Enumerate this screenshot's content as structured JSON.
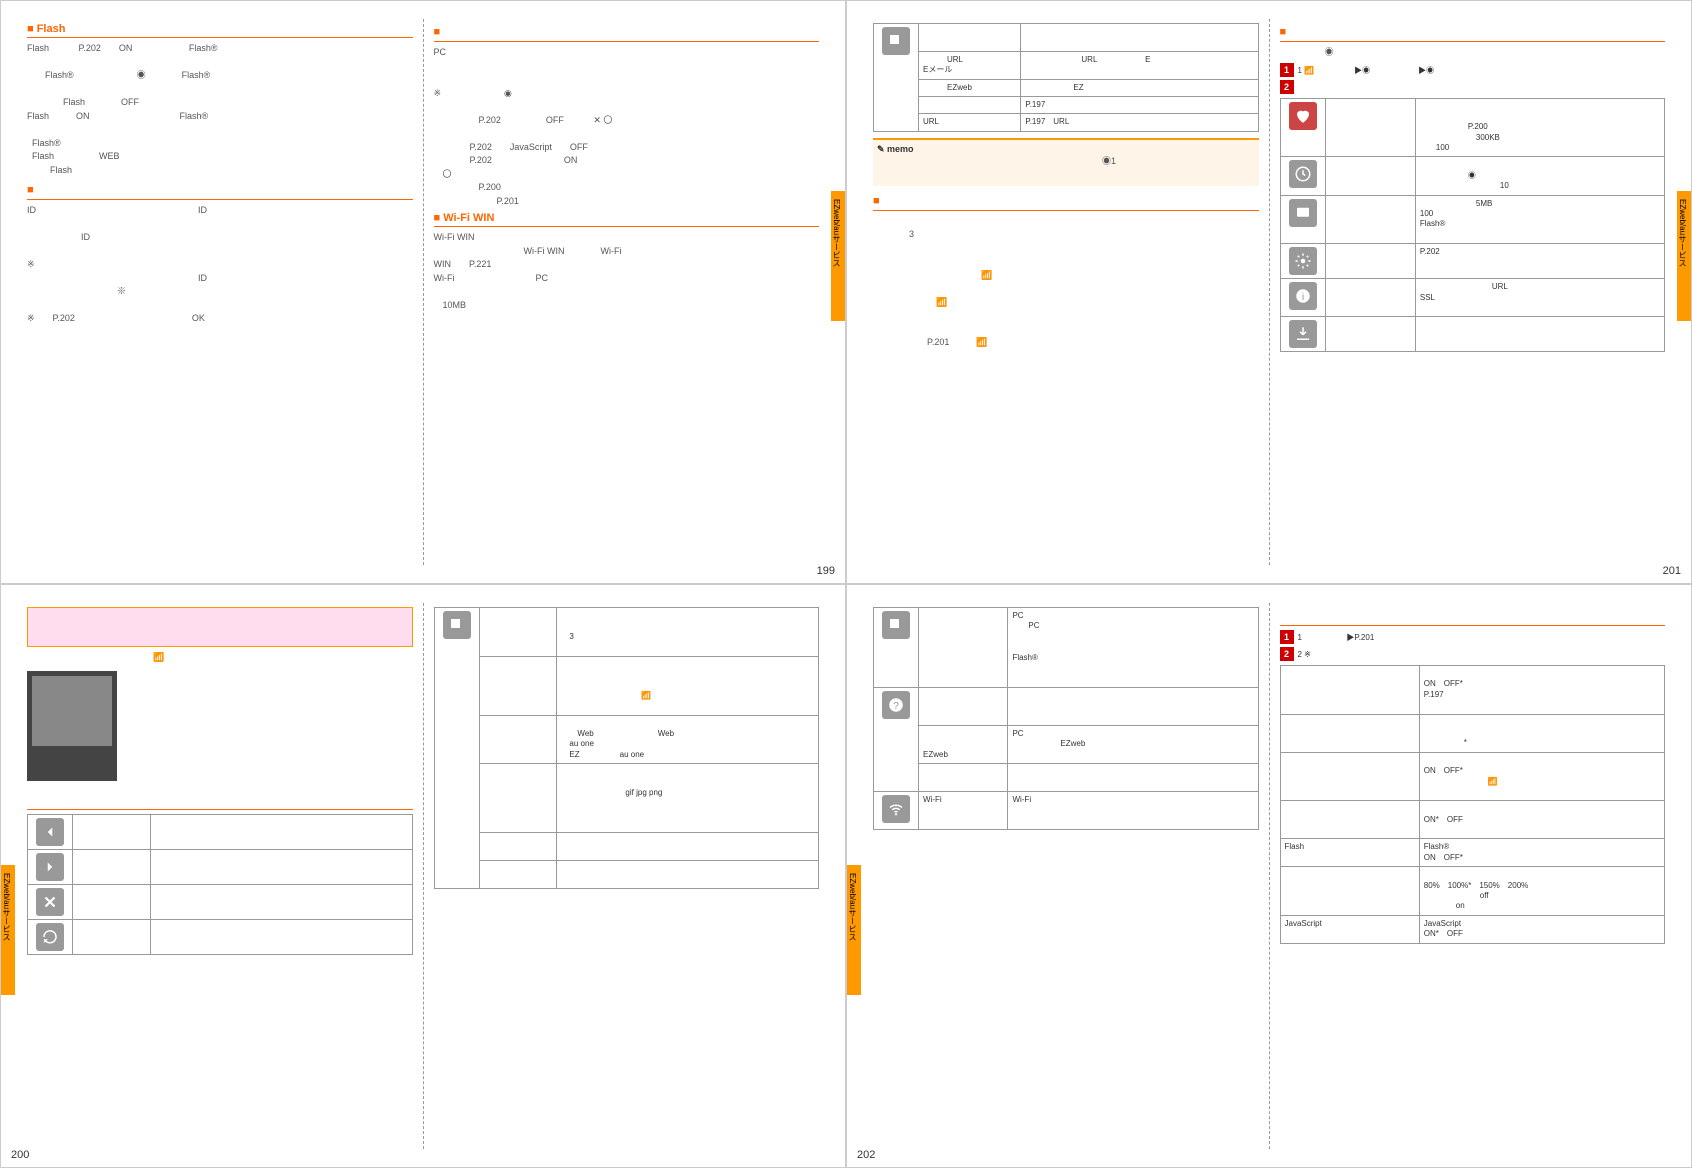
{
  "p199": {
    "flash_title": "■ Flash",
    "flash_body": "Flash 　　　P.202　　ON 　　　　　　Flash®　　　\n\n　　Flash®　　　　　　　◉　　　　Flash®　　　\n\n　　　　Flash　　　　OFF　　　　　　　　\nFlash　　　ON　　　　　　　　　　Flash®　　　\n\n  Flash®　　　　　　　　　　\n  Flash　　　　　WEB　　　　　　　\n  　　Flash　　　　　　　",
    "id_title": "■ 　　　　　　　　",
    "id_body": "ID　　　　　　　　　　　　　　　　　　ID　\n　　　　　　　　　　　　　　　　　　　　　\n　　　　　　ID　　　　　　　　　　\n\n※　　　　　　　　　　　　　　　　　　　　\n　　　　　　　　　　　　　　　　　　　ID\n　　　　　　　　　　※　　　　　　　　　\n\n※　　P.202　　　　　　　　　　　　　OK",
    "pc_title": "■ 　　　　　　　　　　　　　　　",
    "pc_body": "PC　　　　　　　　　　　　　　　　　　\n　　　　　　　　　　　　　　　　　　　　\n\n※　　　　　　　◉　　　　　　　　　　　　\n　　　　　　　　　　　　　　　　　　　　　\n　　　　　P.202　　　　　OFF　　　 ✕ 〇\n　　　　　　\n　　　　P.202　　JavaScript　　OFF　　　\n　　　　P.202　　　　　　　　ON　　　\n　〇\n　　　　　P.200　　　　　　　　\n　　　　　　　P.201",
    "wifi_title": "■ Wi-Fi WIN",
    "wifi_body": "Wi-Fi WIN　　　　　　　　　　　　　　　\n　　　　　　　　　　Wi-Fi WIN　　　　Wi-Fi\nWIN　　P.221　　　　　\nWi-Fi　　　　　　　　　PC　　　　　　　　\n　　　　　　　　　　　　　　　　　　　　　\n　10MB",
    "tab": "EZweb/auサービス",
    "num": "199"
  },
  "p201": {
    "top_title": "■ 　　　　　　　　　",
    "top_body": "　　　　　◉　　　　　　　　　　　",
    "step1": "1  📶　　　　　▶◉　　　　　　▶◉",
    "step2": "2",
    "tbl": [
      {
        "icon": "heart",
        "c1": "　　　　",
        "c2": "　　　　　　　　　　　　　\n　　　　　　　　　\n　　　　　　P.200　\n　　　　　　　300KB\n　　100"
      },
      {
        "icon": "clock",
        "c1": "",
        "c2": "　　　　　　　　　\n　　　　　　◉　　　　\n　　　　　　　　　　10"
      },
      {
        "icon": "screen",
        "c1": "",
        "c2": "　　　　　　　5MB　　　\n100　　　　　　　\nFlash®　　　　　　　　　\n　　　　　　　　　"
      },
      {
        "icon": "gear",
        "c1": "　　",
        "c2": "P.202"
      },
      {
        "icon": "info",
        "c1": "　　　　",
        "c2": "　　　　　　　　　URL\nSSL　　　　　　　　　\n　　　　　　"
      },
      {
        "icon": "download",
        "c1": "",
        "c2": "　　　　　　　　　　　"
      }
    ],
    "left_tbl": [
      {
        "c1": "",
        "c2": "　　　　　　　　　\n　　　"
      },
      {
        "c1": "　　　URL\nEメール",
        "c2": "　　　　　　　URL　　　　　　E\n　　　　　"
      },
      {
        "c1": "　　　EZweb",
        "c2": "　　　　　　EZ　　　　　　　"
      },
      {
        "c1": "",
        "c2": "P.197"
      },
      {
        "c1": "URL　　　",
        "c2": "P.197　URL　　　　　　"
      }
    ],
    "memo_hd": "memo",
    "memo_body": "　　　　　　　　　　　　　　　　　　　　　　　　　◉1　　　\n　　　　　　　　　　　",
    "dl_title": "■ 　　　　　",
    "dl_body": "　　　　　　　　　　　　　　　　　　　　　　　　　　　\n　　　　3　　　　　　　　\n\n　　　　　　　　　　　　　　　　　　　　　　　　　　\n　　　　　　　　　　　　📶\n　　　　　　　　　　　　　　　　　　　　　　　　\n　　　　　　　📶\n　　　　　　　　　　　　　　　　　　　　\n\n　　　　　　P.201　　　📶　　　　　　　　　　　　　",
    "tab": "EZweb/auサービス",
    "num": "201"
  },
  "p200": {
    "top_title": "　　　　　　　　",
    "top_body": "　　　　　　　　　　　　　　📶　　　　　　　　　　",
    "callouts": [
      "　　　　",
      "　　",
      "　　　　　"
    ],
    "mid_title": "　　　　　　　　",
    "left_tbl": [
      {
        "icon": "back",
        "c1": "　　　　",
        "c2": "　　　　　　　　　"
      },
      {
        "icon": "fwd",
        "c1": "　　　　",
        "c2": "　　　　　　　　　"
      },
      {
        "icon": "close",
        "c1": "　　",
        "c2": "　　　　　　　　　　　　　　　　"
      },
      {
        "icon": "reload",
        "c1": "　　　　",
        "c2": "　　　　　　　　　　　　　　　　\n　　　　　"
      }
    ],
    "right_tbl": [
      {
        "icon": "page-fwd",
        "c1": "　　　\n　　",
        "c2": "　　　　　　　　　　　　　　　　\n　　　　　　　　　　　　　　　　\n　3　　　　\n　　"
      },
      {
        "icon": "",
        "c1": "　　　\n　　",
        "c2": "　　　　　　　　　　　　　　　　\n　　　　　　　　　　　　　　　　\n　　　　　\n　　　　　　　　　　📶　　　　\n　　　　　　"
      },
      {
        "icon": "",
        "c1": "　　　\n　　",
        "c2": "　　　　　　　　　　　　　　　　\n　　Web　　　　　　　　Web　　\n　au one　　　　　　　\n　EZ　　　　　au one　　　　"
      },
      {
        "icon": "",
        "c1": "　　　",
        "c2": "　　　　　　　　　　　　　　　　\n　　　　　　　\n　　　　　　　　gif jpg png\n　　　　　　\n　　　　　　　　　　　　　　\n　　　　　　"
      },
      {
        "icon": "",
        "c1": "　　　　\n　　",
        "c2": "　　　　　　　　　　　　　　　　"
      },
      {
        "icon": "",
        "c1": "　　　　\n　　",
        "c2": "　　　"
      }
    ],
    "tab": "EZweb/auサービス",
    "num": "200"
  },
  "p202": {
    "right_tbl": [
      {
        "icon": "page-fwd",
        "c1": "　　　　　",
        "c2": "PC　　　　　　　　　　　　　　\n　　PC　　　　　　　　　　\n　　　　　　　　　　　　　　　　\n　　　　　　　　　　　　　　\nFlash®　　　　　　　　　\n　　　　　　　　　　　　　　　　\n　　　　　　　　　　"
      },
      {
        "icon": "help",
        "c1": "　　　\n　　　\n　　",
        "c2": "　　　　　　　　　　　　　　　　"
      },
      {
        "icon": "",
        "c1": "　　　\n　　　\nEZweb",
        "c2": "PC　　　　　　　　　　　　　　\n　　　　　　EZweb　　　　"
      },
      {
        "icon": "",
        "c1": "　　　\n　　",
        "c2": "　　　　　　　　　　　　　　　　"
      },
      {
        "icon": "wifi",
        "c1": "Wi-Fi",
        "c2": "Wi-Fi　　　　　　　　　　　　　\n　　\n　　　　　　　　　　　　　　　　"
      }
    ],
    "set_title": "　　　　　　　　　　　",
    "step1": "1  　　　　　 ▶P.201　　　　",
    "step2": "2  ※　　　　　　　　　　　　　　　　　　　　",
    "set_tbl": [
      {
        "c1": "　　　　　　　",
        "c2": "　　　　　　　　\nON　OFF*\nP.197　　　　　　　\n　　"
      },
      {
        "c1": "　　　　　",
        "c2": "　　　　　　　　　　　　\n　　\n　　　　　*　　　　　　　"
      },
      {
        "c1": "　　　　",
        "c2": "　　　　　　　　　　　　\nON　OFF*\n　　　　　　　　📶　　　\n　　　　"
      },
      {
        "c1": "　　　",
        "c2": "　　　　　　　　　　　　\nON*　OFF\n　　　　　　　　　　　　"
      },
      {
        "c1": "Flash　　",
        "c2": "Flash®　　　　　　　　　　\nON　OFF*"
      },
      {
        "c1": "　　　　　",
        "c2": "　　　　　　　　　　　　\n80%　100%*　150%　200%\n　　　　　　　off　　　　　\n　　　　on　　　　　"
      },
      {
        "c1": "JavaScript",
        "c2": "JavaScript　　　　　　　　\nON*　OFF"
      }
    ],
    "tab": "EZweb/auサービス",
    "num": "202"
  }
}
